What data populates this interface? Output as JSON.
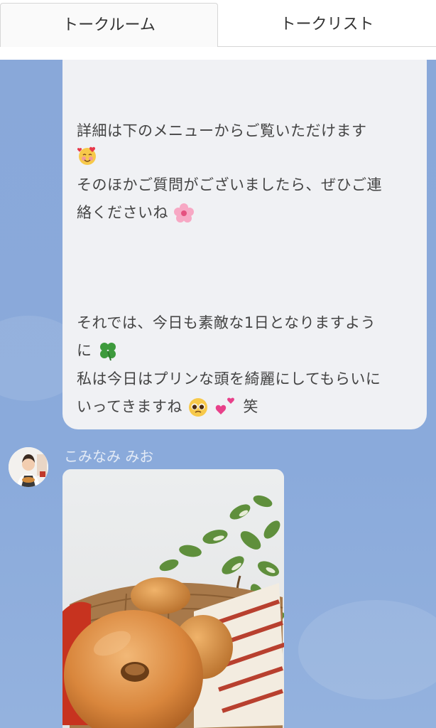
{
  "tabs": {
    "talk_room": "トークルーム",
    "talk_list": "トークリスト"
  },
  "message": {
    "line1": "詳細は下のメニューからご覧いただけます",
    "line3": "そのほかご質問がございましたら、ぜひご連",
    "line4": "絡くださいね",
    "line5": "それでは、今日も素敵な1日となりますよう",
    "line6": "に",
    "line7": "私は今日はプリンな頭を綺麗にしてもらいに",
    "line8": "いってきますね",
    "line8_suffix": "笑",
    "emojis": [
      "smiling-face-with-hearts",
      "cherry-blossom",
      "four-leaf-clover",
      "pleading-face",
      "two-hearts"
    ]
  },
  "sender": {
    "name": "こみなみ みお"
  },
  "colors": {
    "chat_background": "#8aa9d8",
    "bubble": "#f0f1f4",
    "sender_name": "#e4ebf6"
  }
}
